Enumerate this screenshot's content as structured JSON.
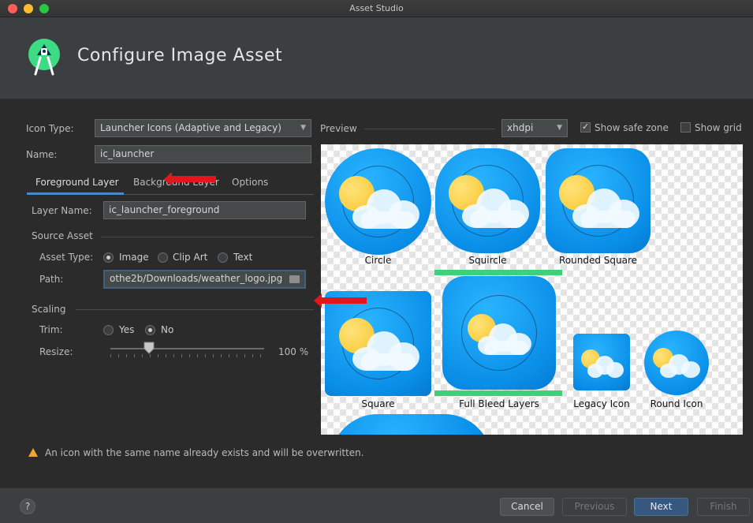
{
  "window": {
    "title": "Asset Studio"
  },
  "header": {
    "title": "Configure Image Asset",
    "logo_icon": "android-studio-icon"
  },
  "form": {
    "icon_type_label": "Icon Type:",
    "icon_type_value": "Launcher Icons (Adaptive and Legacy)",
    "name_label": "Name:",
    "name_value": "ic_launcher"
  },
  "tabs": [
    {
      "label": "Foreground Layer",
      "active": true
    },
    {
      "label": "Background Layer",
      "active": false
    },
    {
      "label": "Options",
      "active": false
    }
  ],
  "layer": {
    "layer_name_label": "Layer Name:",
    "layer_name_value": "ic_launcher_foreground",
    "source_asset_heading": "Source Asset",
    "asset_type_label": "Asset Type:",
    "asset_type_options": [
      "Image",
      "Clip Art",
      "Text"
    ],
    "asset_type_selected": "Image",
    "path_label": "Path:",
    "path_value": "othe2b/Downloads/weather_logo.jpg",
    "scaling_heading": "Scaling",
    "trim_label": "Trim:",
    "trim_options": [
      "Yes",
      "No"
    ],
    "trim_selected": "No",
    "resize_label": "Resize:",
    "resize_value": "100 %",
    "resize_percent": 100
  },
  "preview": {
    "label": "Preview",
    "density": "xhdpi",
    "show_safe_zone_label": "Show safe zone",
    "show_safe_zone": true,
    "show_grid_label": "Show grid",
    "show_grid": false,
    "captions": [
      "Circle",
      "Squircle",
      "Rounded Square",
      "Square",
      "Full Bleed Layers",
      "Legacy Icon",
      "Round Icon"
    ]
  },
  "warning": {
    "text": "An icon with the same name already exists and will be overwritten."
  },
  "footer": {
    "help": "?",
    "cancel": "Cancel",
    "previous": "Previous",
    "next": "Next",
    "finish": "Finish"
  },
  "colors": {
    "accent": "#4a88c7",
    "primary_button": "#365880",
    "annotation_red": "#e4161b"
  }
}
